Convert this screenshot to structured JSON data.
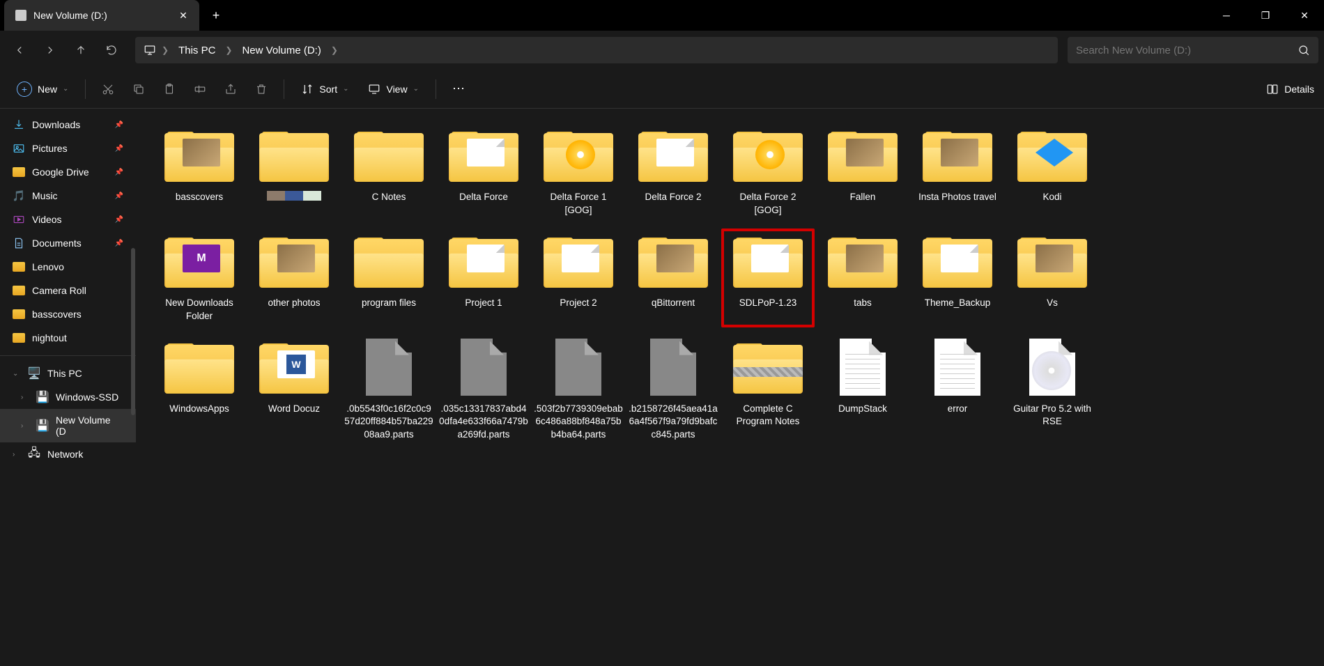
{
  "tab": {
    "title": "New Volume (D:)"
  },
  "breadcrumbs": [
    "This PC",
    "New Volume (D:)"
  ],
  "search": {
    "placeholder": "Search New Volume (D:)"
  },
  "toolbar": {
    "new": "New",
    "sort": "Sort",
    "view": "View",
    "details": "Details"
  },
  "sidebar": {
    "quick": [
      {
        "label": "Downloads",
        "icon": "download",
        "pinned": true
      },
      {
        "label": "Pictures",
        "icon": "pictures",
        "pinned": true
      },
      {
        "label": "Google Drive",
        "icon": "folder",
        "pinned": true
      },
      {
        "label": "Music",
        "icon": "music",
        "pinned": true
      },
      {
        "label": "Videos",
        "icon": "videos",
        "pinned": true
      },
      {
        "label": "Documents",
        "icon": "documents",
        "pinned": true
      },
      {
        "label": "Lenovo",
        "icon": "folder",
        "pinned": false
      },
      {
        "label": "Camera Roll",
        "icon": "folder",
        "pinned": false
      },
      {
        "label": "basscovers",
        "icon": "folder",
        "pinned": false
      },
      {
        "label": "nightout",
        "icon": "folder",
        "pinned": false
      }
    ],
    "pc": {
      "label": "This PC"
    },
    "drives": [
      {
        "label": "Windows-SSD"
      },
      {
        "label": "New Volume (D",
        "active": true
      }
    ],
    "network": {
      "label": "Network"
    }
  },
  "items": [
    {
      "name": "basscovers",
      "type": "folder",
      "preview": "photo"
    },
    {
      "name": "",
      "type": "folder",
      "preview": "swatch"
    },
    {
      "name": "C Notes",
      "type": "folder"
    },
    {
      "name": "Delta Force",
      "type": "folder",
      "preview": "doc"
    },
    {
      "name": "Delta Force 1 [GOG]",
      "type": "folder",
      "preview": "disc"
    },
    {
      "name": "Delta Force 2",
      "type": "folder",
      "preview": "doc"
    },
    {
      "name": "Delta Force 2 [GOG]",
      "type": "folder",
      "preview": "disc"
    },
    {
      "name": "Fallen",
      "type": "folder",
      "preview": "photo"
    },
    {
      "name": "Insta Photos travel",
      "type": "folder",
      "preview": "photo"
    },
    {
      "name": "Kodi",
      "type": "folder",
      "preview": "blue"
    },
    {
      "name": "New Downloads Folder",
      "type": "folder",
      "preview": "purple"
    },
    {
      "name": "other photos",
      "type": "folder",
      "preview": "photo"
    },
    {
      "name": "program files",
      "type": "folder"
    },
    {
      "name": "Project 1",
      "type": "folder",
      "preview": "doc"
    },
    {
      "name": "Project 2",
      "type": "folder",
      "preview": "doc"
    },
    {
      "name": "qBittorrent",
      "type": "folder",
      "preview": "photo"
    },
    {
      "name": "SDLPoP-1.23",
      "type": "folder",
      "preview": "doc",
      "highlighted": true
    },
    {
      "name": "tabs",
      "type": "folder",
      "preview": "photo"
    },
    {
      "name": "Theme_Backup",
      "type": "folder",
      "preview": "doc"
    },
    {
      "name": "Vs",
      "type": "folder",
      "preview": "photo"
    },
    {
      "name": "WindowsApps",
      "type": "folder"
    },
    {
      "name": "Word Docuz",
      "type": "folder",
      "preview": "word"
    },
    {
      "name": ".0b5543f0c16f2c0c957d20ff884b57ba22908aa9.parts",
      "type": "file-gray"
    },
    {
      "name": ".035c13317837abd40dfa4e633f66a7479ba269fd.parts",
      "type": "file-gray"
    },
    {
      "name": ".503f2b7739309ebab6c486a88bf848a75bb4ba64.parts",
      "type": "file-gray"
    },
    {
      "name": ".b2158726f45aea41a6a4f567f9a79fd9bafcc845.parts",
      "type": "file-gray"
    },
    {
      "name": "Complete C Program Notes",
      "type": "zip"
    },
    {
      "name": "DumpStack",
      "type": "file-text"
    },
    {
      "name": "error",
      "type": "file-text"
    },
    {
      "name": "Guitar Pro 5.2 with RSE",
      "type": "file-cd"
    }
  ]
}
